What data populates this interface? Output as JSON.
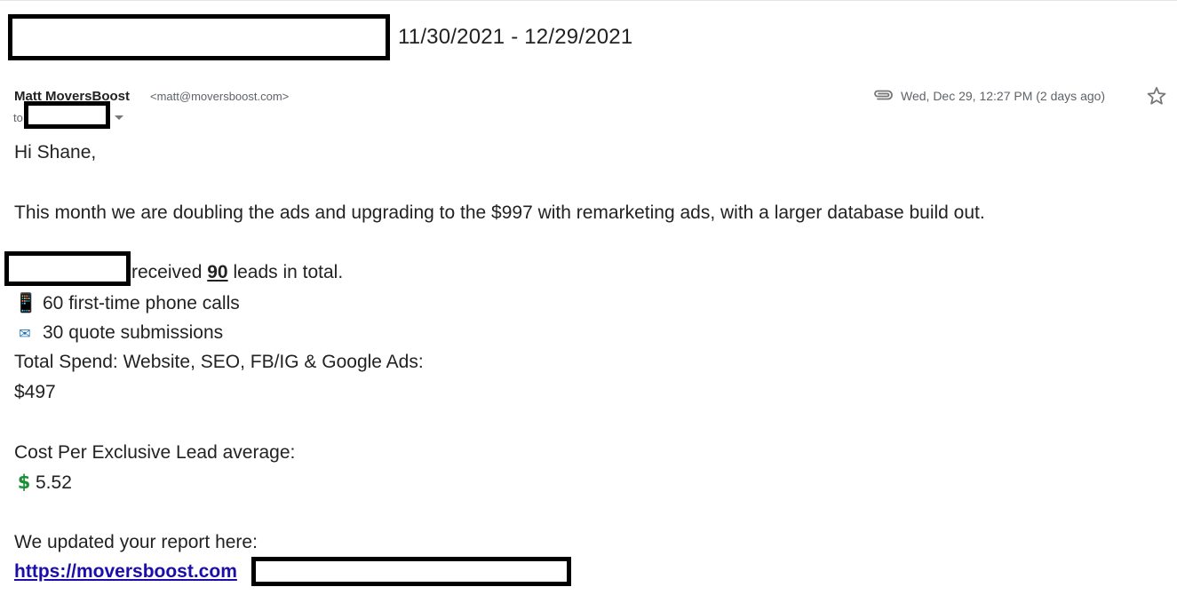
{
  "email": {
    "subject_dates": "11/30/2021 - 12/29/2021",
    "sender_name": "Matt MoversBoost",
    "sender_email": "<matt@moversboost.com>",
    "to_label": "to",
    "date": "Wed, Dec 29, 12:27 PM (2 days ago)"
  },
  "body": {
    "greeting": "Hi Shane,",
    "intro": "This month we are doubling the ads and upgrading to the $997 with remarketing ads, with a larger database build out.",
    "leads_prefix": "received",
    "leads_count": "90",
    "leads_suffix": "leads in total.",
    "phone_calls": "60 first-time phone calls",
    "quote_submissions": "30 quote submissions",
    "spend_label": "Total Spend: Website, SEO, FB/IG & Google Ads:",
    "spend_value": "$497",
    "cpl_label": "Cost Per Exclusive Lead average:",
    "cpl_value": "5.52",
    "report_intro": "We updated your report here:",
    "report_link": "https://moversboost.com"
  },
  "icons": {
    "attachment": "paperclip-icon",
    "star": "star-outline-icon",
    "phone": "mobile-phone-emoji",
    "email": "email-emoji",
    "dollar": "dollar-sign-emoji"
  },
  "colors": {
    "link": "#1a0dab",
    "muted": "#5f6368",
    "text": "#222222",
    "redaction": "#000000"
  }
}
